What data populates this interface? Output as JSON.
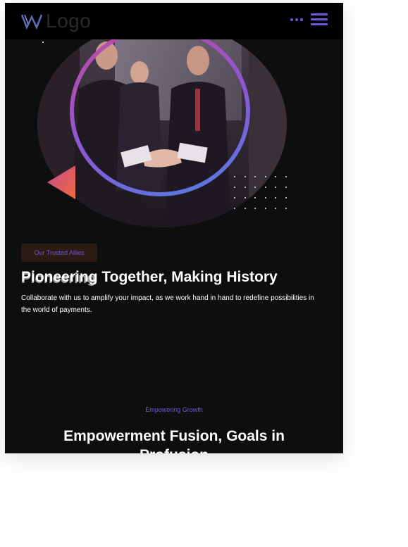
{
  "header": {
    "logo_text": "Logo",
    "logo_icon": "w-logo-icon",
    "more_icon": "dots-icon",
    "menu_icon": "hamburger-menu-icon",
    "accent_color": "#6e5ad6"
  },
  "hero": {
    "image": "business-handshake-photo",
    "ring_gradient": [
      "#c44aa0",
      "#8a58d6",
      "#4f7fe0"
    ],
    "triangle_gradient": [
      "#e0476f",
      "#f27a3a"
    ]
  },
  "allies": {
    "badge": "Our Trusted Allies",
    "title_overlap": "Pioneering",
    "title": "Pioneering Together, Making History",
    "description": "Collaborate with us to amplify your impact, as we work hand in hand to redefine possibilities in the world of payments."
  },
  "growth": {
    "kicker": "Empowering Growth",
    "title": "Empowerment Fusion, Goals in Profusion"
  }
}
